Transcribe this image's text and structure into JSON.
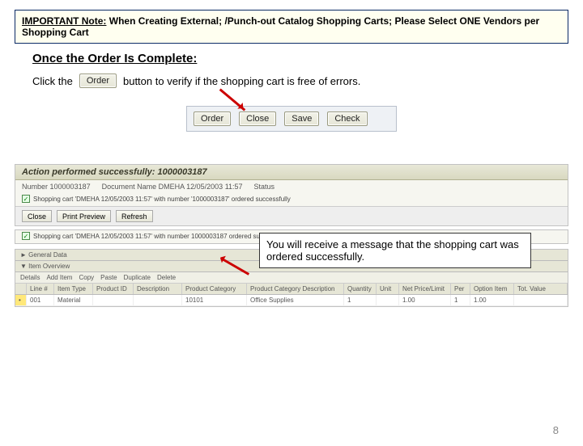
{
  "note": {
    "prefix": "IMPORTANT Note:",
    "rest": " When Creating External; /Punch-out Catalog Shopping Carts; Please Select ONE Vendors per Shopping Cart"
  },
  "heading": "Once the Order Is Complete:",
  "line1": {
    "pre": "Click the",
    "order_btn": "Order",
    "post": "button to verify if the shopping cart is free of errors."
  },
  "button_row": {
    "order": "Order",
    "close": "Close",
    "save": "Save",
    "check": "Check"
  },
  "callout": "You will receive a message that the shopping cart was ordered successfully.",
  "sap1": {
    "header": "Action performed successfully: 1000003187",
    "number_label": "Number",
    "number": "1000003187",
    "docname_label": "Document Name",
    "docname": "DMEHA 12/05/2003 11:57",
    "status_label": "Status",
    "green_line": "Shopping cart 'DMEHA 12/05/2003 11:57' with number '1000003187' ordered successfully",
    "btn_close": "Close",
    "btn_print": "Print Preview",
    "btn_refresh": "Refresh"
  },
  "sap2": {
    "header2": "Action performed successfully: 1000003187",
    "green_line2": "Shopping cart 'DMEHA 12/05/2003 11:57' with number 1000003187 ordered successfully"
  },
  "table": {
    "section": "► General Data",
    "overview": "▼ Item Overview",
    "toolbar": [
      "Details",
      "Add Item",
      "Copy",
      "Paste",
      "Duplicate",
      "Delete"
    ],
    "cols": [
      "",
      "Line #",
      "Item Type",
      "Product ID",
      "Description",
      "Product Category",
      "Product Category Description",
      "Quantity",
      "Unit",
      "Net Price/Limit",
      "Per",
      "Option Item",
      "Tot. Value"
    ],
    "row1": [
      "•",
      "001",
      "Material",
      "",
      "",
      "10101",
      "Office Supplies",
      "1",
      "",
      "1.00",
      "1",
      "1.00",
      ""
    ]
  },
  "page": "8"
}
